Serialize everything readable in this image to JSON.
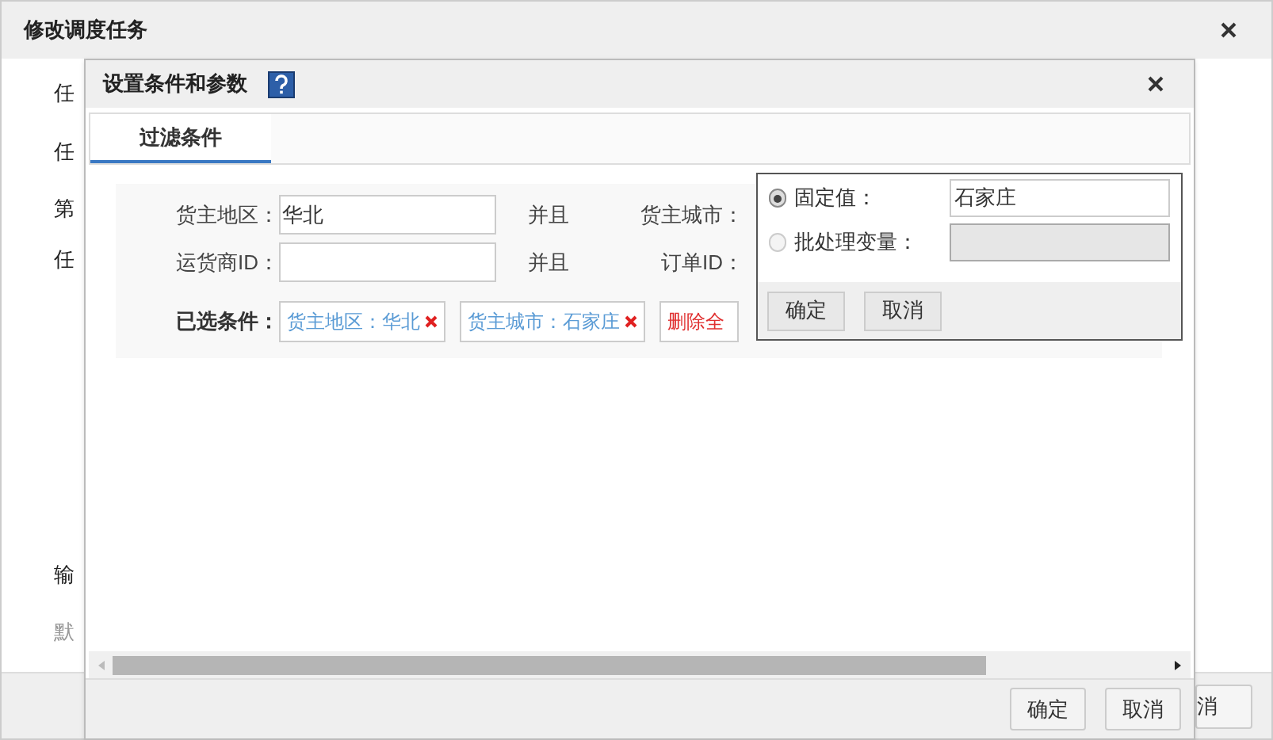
{
  "background_dialog": {
    "title": "修改调度任务",
    "labels": [
      "任",
      "任",
      "第",
      "任",
      "输",
      "默"
    ],
    "cancel_button": "消"
  },
  "dialog": {
    "title": "设置条件和参数",
    "tabs": [
      {
        "label": "过滤条件",
        "selected": true
      }
    ],
    "rows": [
      {
        "label": "货主地区：",
        "value": "华北",
        "connector": "并且",
        "next_label": "货主城市："
      },
      {
        "label": "运货商ID：",
        "connector": "并且",
        "next_label": "订单ID："
      }
    ],
    "selected_conditions": {
      "label": "已选条件：",
      "tags": [
        "货主地区：华北",
        "货主城市：石家庄"
      ],
      "delete_all": "删除全"
    },
    "buttons": [
      "确定",
      "取消"
    ]
  },
  "popup": {
    "options": [
      {
        "label": "固定值：",
        "selected": true,
        "disabled": false,
        "value": "石家庄"
      },
      {
        "label": "批处理变量：",
        "selected": false,
        "disabled": true
      }
    ],
    "buttons": [
      "确定",
      "取消"
    ]
  }
}
